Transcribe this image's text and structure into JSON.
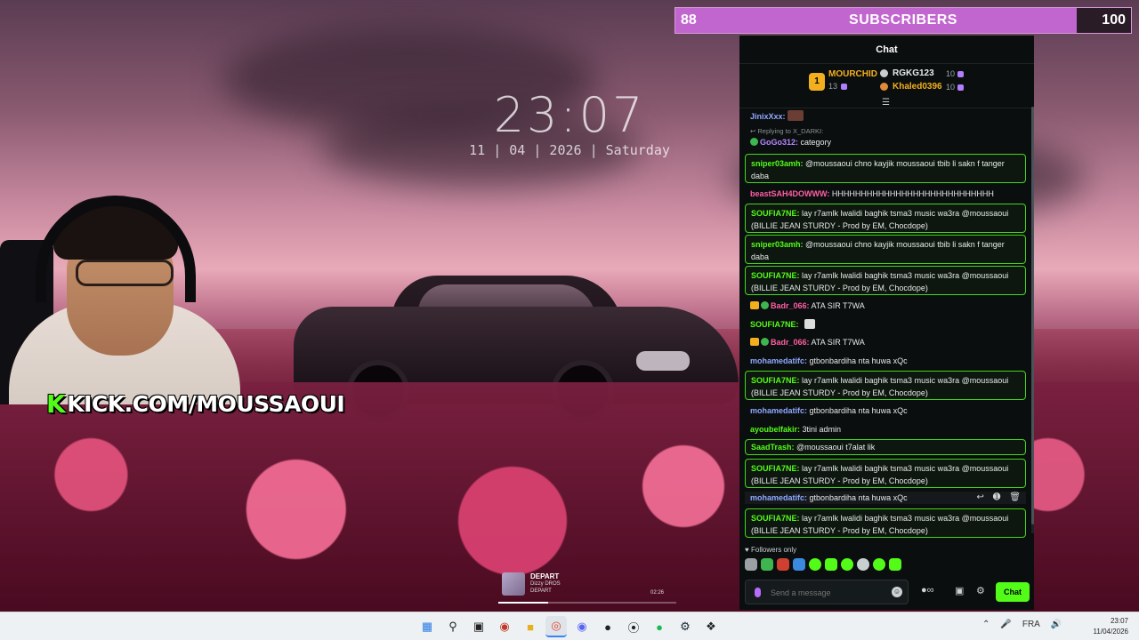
{
  "wallpaper_clock": {
    "time": "23:07",
    "date": "11 | 04 | 2026 | Saturday"
  },
  "overlay": {
    "brand_k": "K",
    "brand_text": "KICK.COM/MOUSSAOUI"
  },
  "subscriber_goal": {
    "current": "88",
    "title": "SUBSCRIBERS",
    "target": "100",
    "progress_fraction": 0.88,
    "accent_color": "#c266cf"
  },
  "chat": {
    "header_title": "Chat",
    "leaderboard": [
      {
        "rank": "1",
        "name": "MOURCHID",
        "count": "13"
      },
      {
        "name": "RGKG123",
        "count": "10"
      },
      {
        "name": "Khaled0396",
        "count": "10"
      }
    ],
    "messages": [
      {
        "user": "JinixXxx:",
        "text": ""
      },
      {
        "reply": "Replying to X_DARKI:",
        "user": "GoGo312:",
        "text": " category"
      },
      {
        "user": "sniper03amh:",
        "text": " @moussaoui chno kayjik moussaoui tbib li sakn f tanger daba"
      },
      {
        "user": "beastSAH4DOWWW:",
        "text": " HHHHHHHHHHHHHHHHHHHHHHHHHHHH"
      },
      {
        "user": "SOUFIA7NE:",
        "text": " lay r7amlk lwalidi baghik tsma3 music wa3ra @moussaoui (BILLIE JEAN STURDY - Prod by EM, Chocdope)"
      },
      {
        "user": "sniper03amh:",
        "text": " @moussaoui chno kayjik moussaoui tbib li sakn f tanger daba"
      },
      {
        "user": "SOUFIA7NE:",
        "text": " lay r7amlk lwalidi baghik tsma3 music wa3ra @moussaoui (BILLIE JEAN STURDY - Prod by EM, Chocdope)"
      },
      {
        "user": "Badr_066:",
        "text": " ATA SIR T7WA"
      },
      {
        "user": "SOUFIA7NE:",
        "text": ""
      },
      {
        "user": "Badr_066:",
        "text": " ATA SIR T7WA"
      },
      {
        "user": "mohamedatifc:",
        "text": " gtbonbardiha nta huwa xQc"
      },
      {
        "user": "SOUFIA7NE:",
        "text": " lay r7amlk lwalidi baghik tsma3 music wa3ra @moussaoui (BILLIE JEAN STURDY - Prod by EM, Chocdope)"
      },
      {
        "user": "mohamedatifc:",
        "text": " gtbonbardiha nta huwa xQc"
      },
      {
        "user": "ayoubelfakir:",
        "text": " 3tini admin"
      },
      {
        "user": "SaadTrash:",
        "text": " @moussaoui t7alat lik"
      },
      {
        "user": "SOUFIA7NE:",
        "text": " lay r7amlk lwalidi baghik tsma3 music wa3ra @moussaoui (BILLIE JEAN STURDY - Prod by EM, Chocdope)"
      },
      {
        "user": "mohamedatifc:",
        "text": " gtbonbardiha nta huwa xQc"
      },
      {
        "user": "SOUFIA7NE:",
        "text": " lay r7amlk lwalidi baghik tsma3 music wa3ra @moussaoui (BILLIE JEAN STURDY - Prod by EM, Chocdope)"
      }
    ],
    "followers_only": "Followers only",
    "input_placeholder": "Send a message",
    "send_label": "Chat"
  },
  "media": {
    "title": "DEPART",
    "artist": "Dizzy DROS",
    "album": "DEPART",
    "time": "02:26",
    "progress_fraction": 0.28
  },
  "taskbar": {
    "language": "FRA",
    "time": "23:07",
    "date": "11/04/2026"
  },
  "colors": {
    "kick_green": "#53fc18",
    "chat_bg": "#0b0e0f"
  }
}
